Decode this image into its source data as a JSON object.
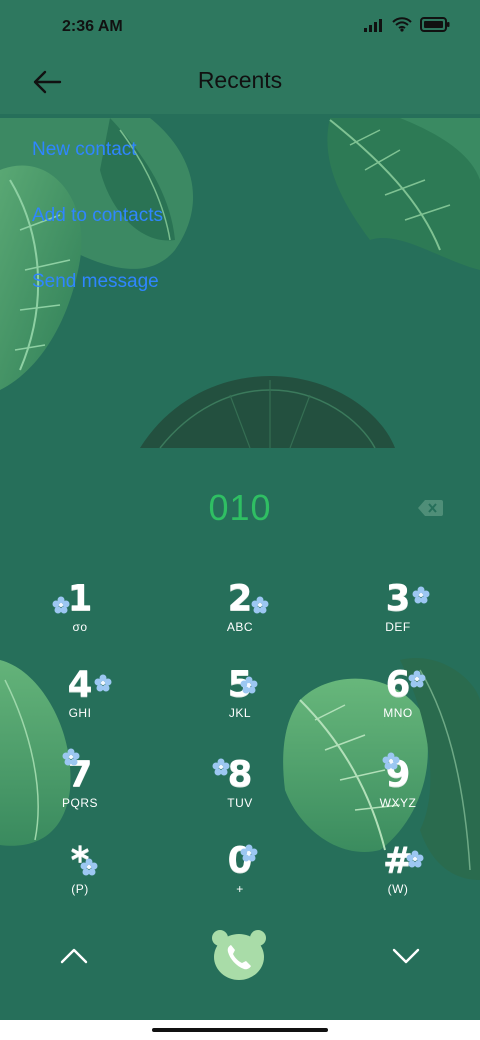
{
  "status_bar": {
    "time": "2:36 AM",
    "icons": [
      "signal-icon",
      "wifi-icon",
      "battery-icon"
    ]
  },
  "header": {
    "title": "Recents",
    "back_icon": "back-arrow-icon"
  },
  "actions": [
    {
      "label": "New contact"
    },
    {
      "label": "Add to contacts"
    },
    {
      "label": "Send message"
    }
  ],
  "dialer": {
    "number": "010",
    "backspace_icon": "backspace-icon"
  },
  "keypad": [
    {
      "digit": "1",
      "letters": "σο"
    },
    {
      "digit": "2",
      "letters": "ABC"
    },
    {
      "digit": "3",
      "letters": "DEF"
    },
    {
      "digit": "4",
      "letters": "GHI"
    },
    {
      "digit": "5",
      "letters": "JKL"
    },
    {
      "digit": "6",
      "letters": "MNO"
    },
    {
      "digit": "7",
      "letters": "PQRS"
    },
    {
      "digit": "8",
      "letters": "TUV"
    },
    {
      "digit": "9",
      "letters": "WXYZ"
    },
    {
      "digit": "*",
      "letters": "(P)"
    },
    {
      "digit": "0",
      "letters": "+"
    },
    {
      "digit": "#",
      "letters": "(W)"
    }
  ],
  "bottom": {
    "collapse_icon": "chevron-up-icon",
    "call_icon": "phone-icon",
    "expand_icon": "chevron-down-icon"
  },
  "colors": {
    "background": "#266f5a",
    "link": "#2f86ff",
    "number": "#2fbf63",
    "call_button": "#a9dca8"
  }
}
